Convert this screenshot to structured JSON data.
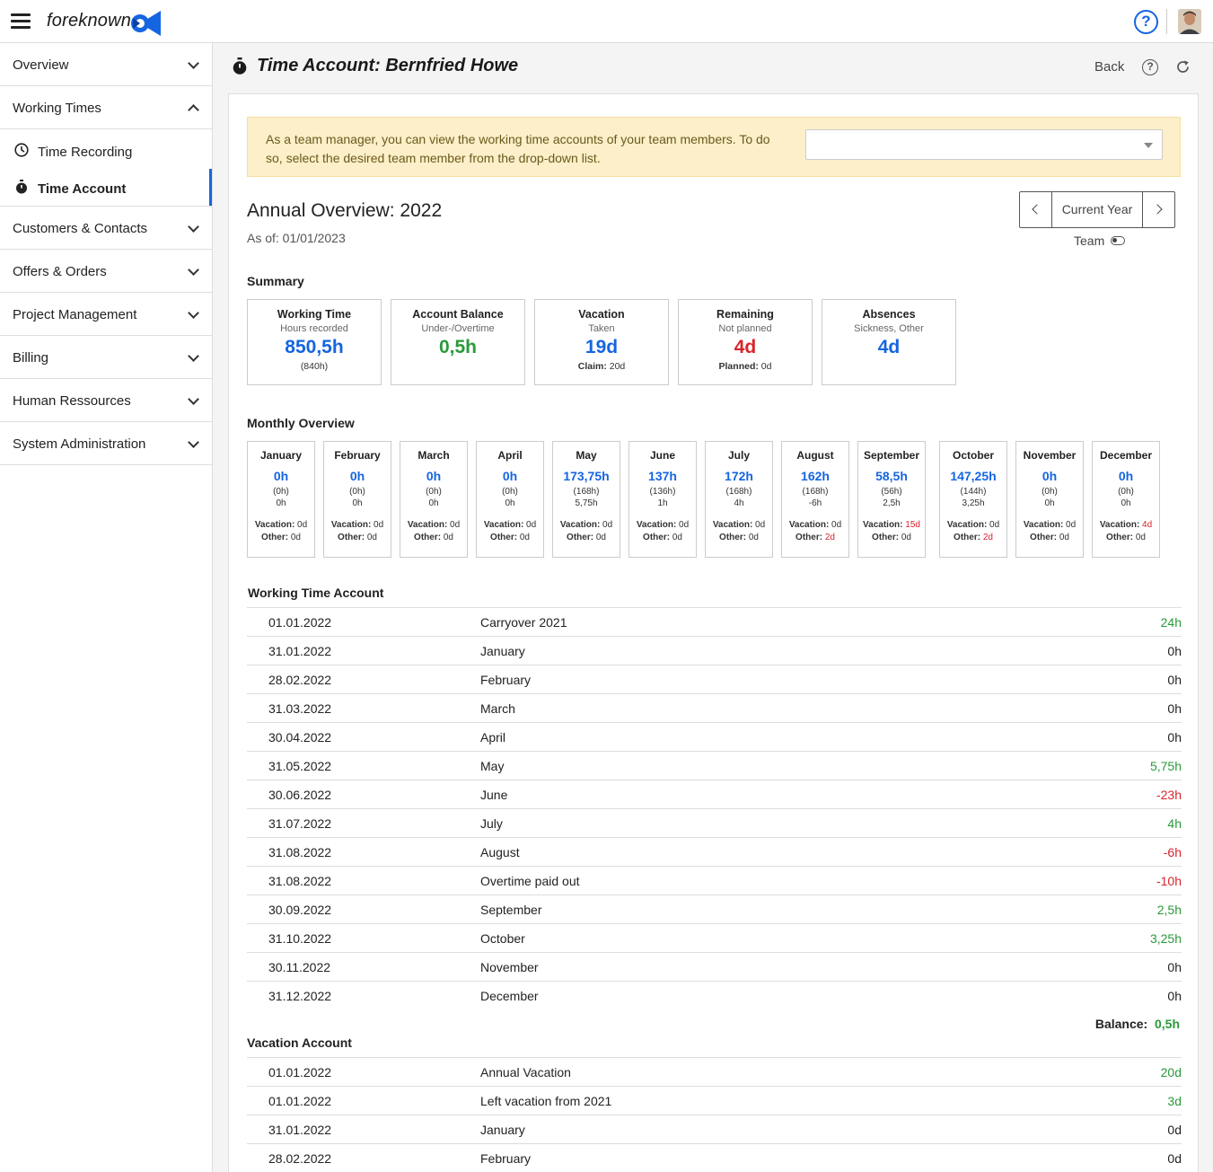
{
  "app": {
    "logo_text": "foreknown",
    "help_label": "?"
  },
  "sidebar": {
    "groups": [
      {
        "label": "Overview"
      },
      {
        "label": "Working Times"
      },
      {
        "label": "Customers & Contacts"
      },
      {
        "label": "Offers & Orders"
      },
      {
        "label": "Project Management"
      },
      {
        "label": "Billing"
      },
      {
        "label": "Human Ressources"
      },
      {
        "label": "System Administration"
      }
    ],
    "sub_items": [
      {
        "label": "Time Recording"
      },
      {
        "label": "Time Account"
      }
    ]
  },
  "header": {
    "title": "Time Account:  Bernfried Howe",
    "back_label": "Back",
    "help_label": "?"
  },
  "notice": {
    "text": "As a team manager, you can view the working time accounts of your team members. To do so, select the desired team member from the drop-down list.",
    "select_value": ""
  },
  "annual": {
    "title": "Annual Overview:  2022",
    "as_of": "As of: 01/01/2023",
    "current_year_label": "Current Year",
    "team_label": "Team"
  },
  "summary": {
    "heading": "Summary",
    "cards": [
      {
        "title": "Working Time",
        "subtitle": "Hours recorded",
        "value": "850,5h",
        "value_color": "blue",
        "foot_label": "",
        "foot_value": "(840h)"
      },
      {
        "title": "Account Balance",
        "subtitle": "Under-/Overtime",
        "value": "0,5h",
        "value_color": "green",
        "foot_label": "",
        "foot_value": ""
      },
      {
        "title": "Vacation",
        "subtitle": "Taken",
        "value": "19d",
        "value_color": "blue",
        "foot_label": "Claim:",
        "foot_value": " 20d"
      },
      {
        "title": "Remaining",
        "subtitle": "Not planned",
        "value": "4d",
        "value_color": "red",
        "foot_label": "Planned:",
        "foot_value": " 0d"
      },
      {
        "title": "Absences",
        "subtitle": "Sickness, Other",
        "value": "4d",
        "value_color": "blue",
        "foot_label": "",
        "foot_value": ""
      }
    ]
  },
  "monthly": {
    "heading": "Monthly Overview",
    "vacation_label": "Vacation:",
    "other_label": "Other:",
    "months": [
      {
        "name": "January",
        "value": "0h",
        "planned": "(0h)",
        "diff": "0h",
        "diff_color": "default",
        "vacation": " 0d",
        "vacation_color": "default",
        "other": " 0d",
        "other_color": "default"
      },
      {
        "name": "February",
        "value": "0h",
        "planned": "(0h)",
        "diff": "0h",
        "diff_color": "default",
        "vacation": " 0d",
        "vacation_color": "default",
        "other": " 0d",
        "other_color": "default"
      },
      {
        "name": "March",
        "value": "0h",
        "planned": "(0h)",
        "diff": "0h",
        "diff_color": "default",
        "vacation": " 0d",
        "vacation_color": "default",
        "other": " 0d",
        "other_color": "default"
      },
      {
        "name": "April",
        "value": "0h",
        "planned": "(0h)",
        "diff": "0h",
        "diff_color": "default",
        "vacation": " 0d",
        "vacation_color": "default",
        "other": " 0d",
        "other_color": "default"
      },
      {
        "name": "May",
        "value": "173,75h",
        "planned": "(168h)",
        "diff": "5,75h",
        "diff_color": "green",
        "vacation": " 0d",
        "vacation_color": "default",
        "other": " 0d",
        "other_color": "default"
      },
      {
        "name": "June",
        "value": "137h",
        "planned": "(136h)",
        "diff": "1h",
        "diff_color": "green",
        "vacation": " 0d",
        "vacation_color": "default",
        "other": " 0d",
        "other_color": "default"
      },
      {
        "name": "July",
        "value": "172h",
        "planned": "(168h)",
        "diff": "4h",
        "diff_color": "green",
        "vacation": " 0d",
        "vacation_color": "default",
        "other": " 0d",
        "other_color": "default"
      },
      {
        "name": "August",
        "value": "162h",
        "planned": "(168h)",
        "diff": "-6h",
        "diff_color": "red",
        "vacation": " 0d",
        "vacation_color": "default",
        "other": " 2d",
        "other_color": "red"
      },
      {
        "name": "September",
        "value": "58,5h",
        "planned": "(56h)",
        "diff": "2,5h",
        "diff_color": "green",
        "vacation": " 15d",
        "vacation_color": "red",
        "other": " 0d",
        "other_color": "default"
      },
      {
        "name": "October",
        "value": "147,25h",
        "planned": "(144h)",
        "diff": "3,25h",
        "diff_color": "green",
        "vacation": " 0d",
        "vacation_color": "default",
        "other": " 2d",
        "other_color": "red"
      },
      {
        "name": "November",
        "value": "0h",
        "planned": "(0h)",
        "diff": "0h",
        "diff_color": "default",
        "vacation": " 0d",
        "vacation_color": "default",
        "other": " 0d",
        "other_color": "default"
      },
      {
        "name": "December",
        "value": "0h",
        "planned": "(0h)",
        "diff": "0h",
        "diff_color": "default",
        "vacation": " 4d",
        "vacation_color": "red",
        "other": " 0d",
        "other_color": "default"
      }
    ]
  },
  "working_time_account": {
    "heading": "Working Time Account",
    "rows": [
      {
        "date": "01.01.2022",
        "label": "Carryover 2021",
        "value": "24h",
        "color": "green"
      },
      {
        "date": "31.01.2022",
        "label": "January",
        "value": "0h",
        "color": "default"
      },
      {
        "date": "28.02.2022",
        "label": "February",
        "value": "0h",
        "color": "default"
      },
      {
        "date": "31.03.2022",
        "label": "March",
        "value": "0h",
        "color": "default"
      },
      {
        "date": "30.04.2022",
        "label": "April",
        "value": "0h",
        "color": "default"
      },
      {
        "date": "31.05.2022",
        "label": "May",
        "value": "5,75h",
        "color": "green"
      },
      {
        "date": "30.06.2022",
        "label": "June",
        "value": "-23h",
        "color": "red"
      },
      {
        "date": "31.07.2022",
        "label": "July",
        "value": "4h",
        "color": "green"
      },
      {
        "date": "31.08.2022",
        "label": "August",
        "value": "-6h",
        "color": "red"
      },
      {
        "date": "31.08.2022",
        "label": "Overtime paid out",
        "value": "-10h",
        "color": "red"
      },
      {
        "date": "30.09.2022",
        "label": "September",
        "value": "2,5h",
        "color": "green"
      },
      {
        "date": "31.10.2022",
        "label": "October",
        "value": "3,25h",
        "color": "green"
      },
      {
        "date": "30.11.2022",
        "label": "November",
        "value": "0h",
        "color": "default"
      },
      {
        "date": "31.12.2022",
        "label": "December",
        "value": "0h",
        "color": "default"
      }
    ],
    "balance_label": "Balance:",
    "balance_value": "0,5h"
  },
  "vacation_account": {
    "heading": "Vacation Account",
    "rows": [
      {
        "date": "01.01.2022",
        "label": "Annual Vacation",
        "value": "20d",
        "color": "green"
      },
      {
        "date": "01.01.2022",
        "label": "Left vacation from 2021",
        "value": "3d",
        "color": "green"
      },
      {
        "date": "31.01.2022",
        "label": "January",
        "value": "0d",
        "color": "default"
      },
      {
        "date": "28.02.2022",
        "label": "February",
        "value": "0d",
        "color": "default"
      }
    ]
  },
  "colors": {
    "blue": "#1565e0",
    "green": "#2a9a3a",
    "red": "#d8242c"
  }
}
